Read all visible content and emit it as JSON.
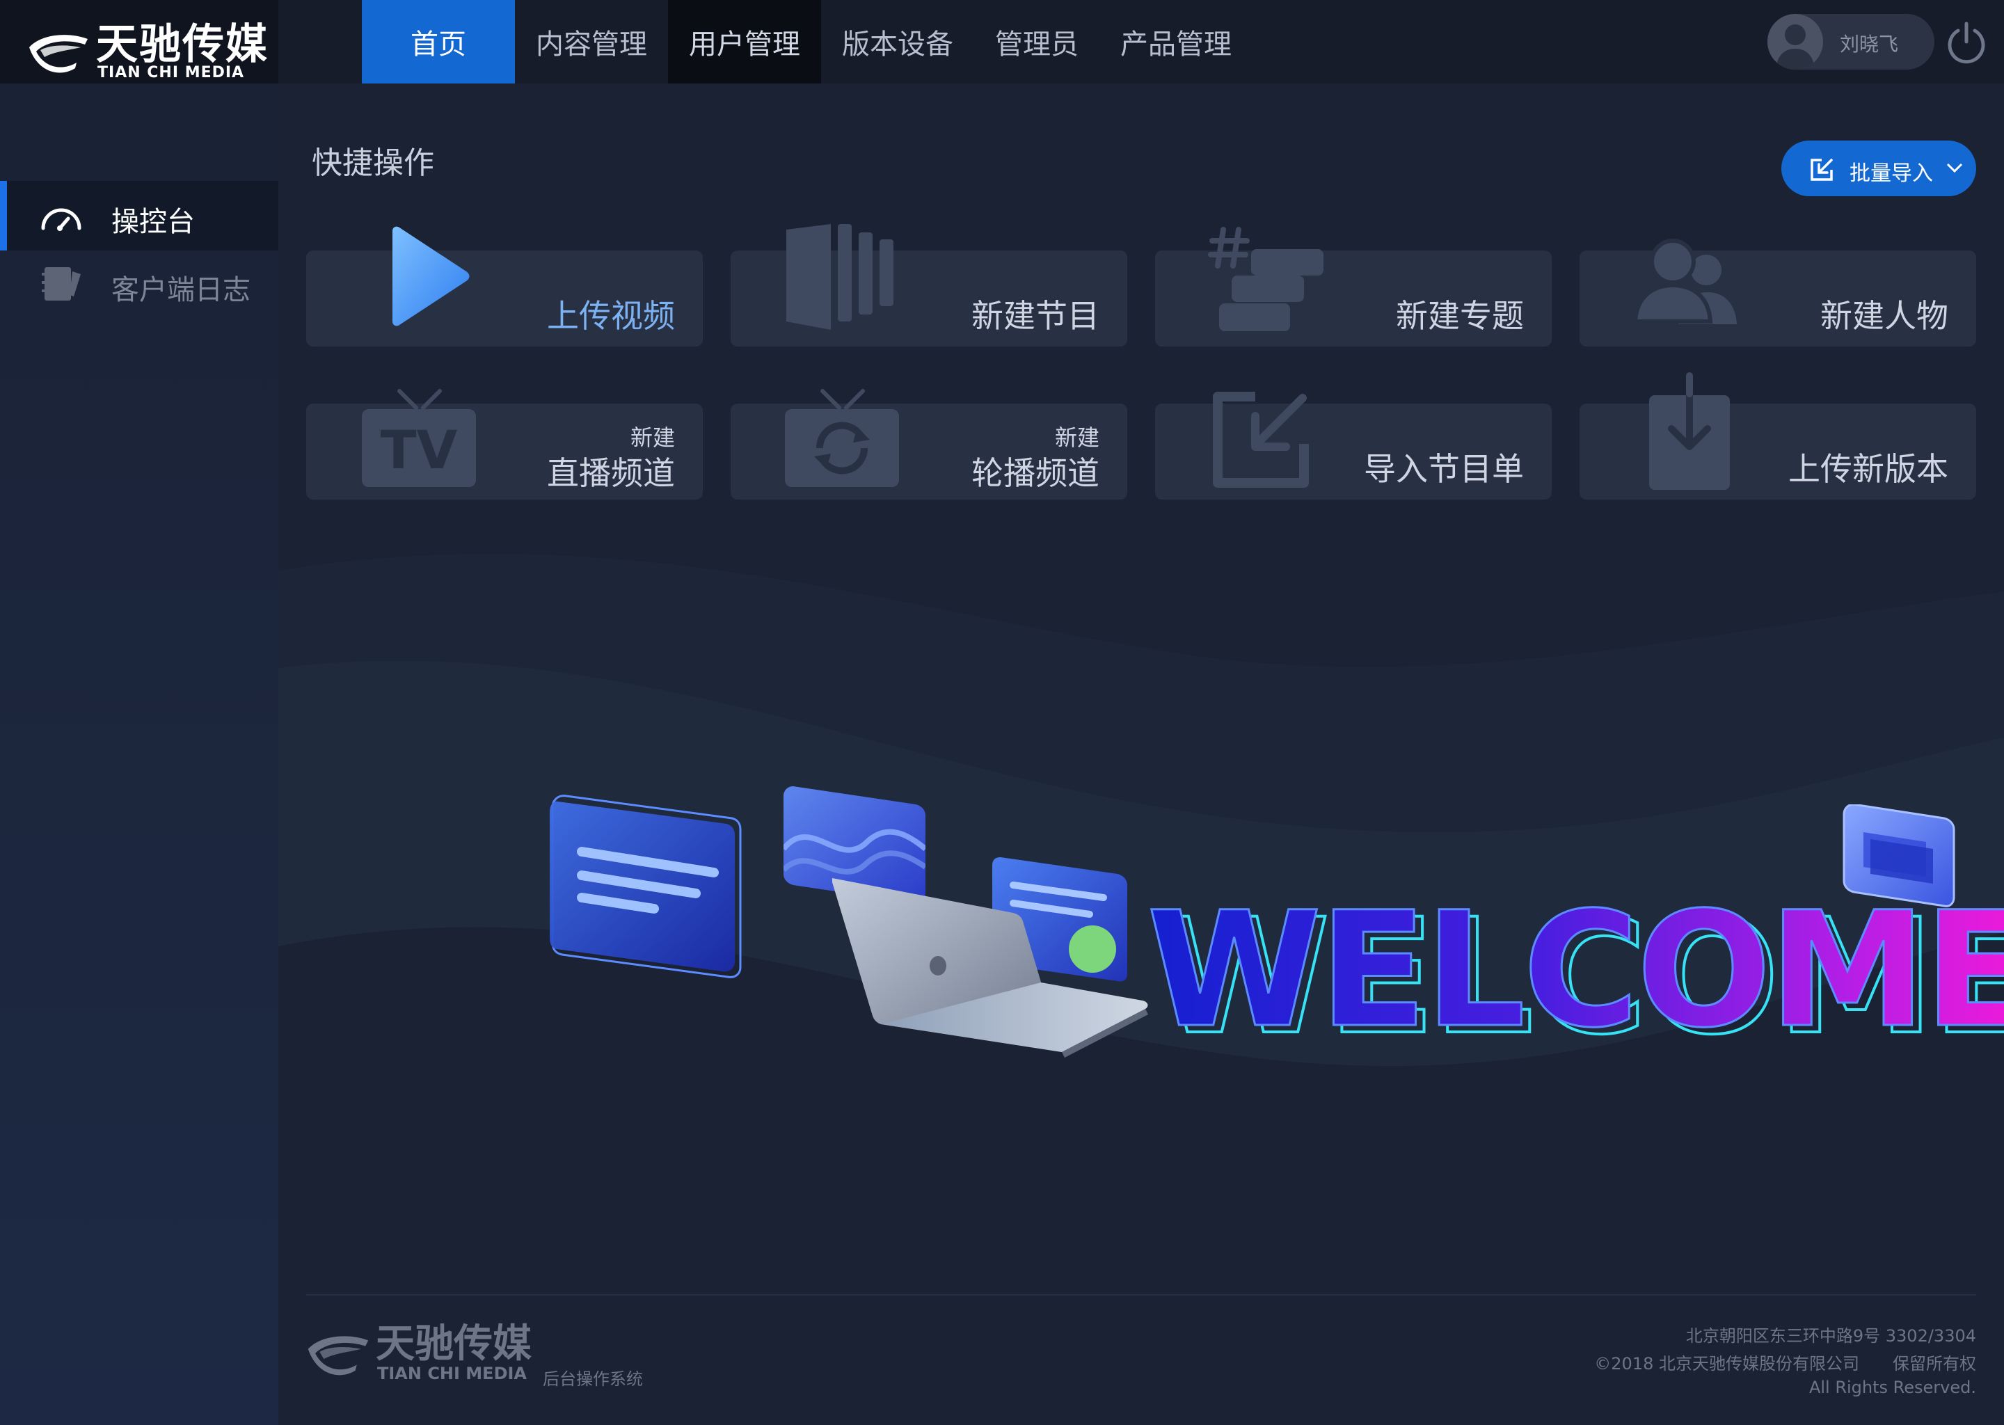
{
  "brand": {
    "name_cn": "天驰传媒",
    "name_en": "TIAN CHI MEDIA"
  },
  "nav": {
    "items": [
      {
        "label": "首页",
        "state": "active"
      },
      {
        "label": "内容管理",
        "state": "normal"
      },
      {
        "label": "用户管理",
        "state": "hover"
      },
      {
        "label": "版本设备",
        "state": "normal"
      },
      {
        "label": "管理员",
        "state": "normal"
      },
      {
        "label": "产品管理",
        "state": "normal"
      }
    ]
  },
  "user": {
    "name": "刘晓飞",
    "avatar_icon": "user-avatar-icon",
    "logout_icon": "power-icon"
  },
  "sidebar": {
    "items": [
      {
        "label": "操控台",
        "icon": "gauge-icon",
        "active": true
      },
      {
        "label": "客户端日志",
        "icon": "notebook-icon",
        "active": false
      }
    ]
  },
  "quick": {
    "title": "快捷操作",
    "batch_import": "批量导入",
    "cards": [
      {
        "label": "上传视频",
        "icon": "play-icon",
        "highlight": true
      },
      {
        "label": "新建节目",
        "icon": "columns-icon"
      },
      {
        "label": "新建专题",
        "icon": "hashtag-stack-icon"
      },
      {
        "label": "新建人物",
        "icon": "people-icon"
      },
      {
        "prefix": "新建",
        "label": "直播频道",
        "icon": "tv-icon"
      },
      {
        "prefix": "新建",
        "label": "轮播频道",
        "icon": "carousel-tv-icon"
      },
      {
        "label": "导入节目单",
        "icon": "import-icon"
      },
      {
        "label": "上传新版本",
        "icon": "download-box-icon"
      }
    ]
  },
  "welcome": {
    "text": "WELCOME"
  },
  "footer": {
    "system_name": "后台操作系统",
    "address": "北京朝阳区东三环中路9号 3302/3304",
    "copyright": "©2018 北京天驰传媒股份有限公司　　保留所有权",
    "rights": "All Rights Reserved."
  },
  "colors": {
    "accent": "#1468d2",
    "background": "#1b2233",
    "card": "#283043",
    "icon": "#3f4a60"
  }
}
